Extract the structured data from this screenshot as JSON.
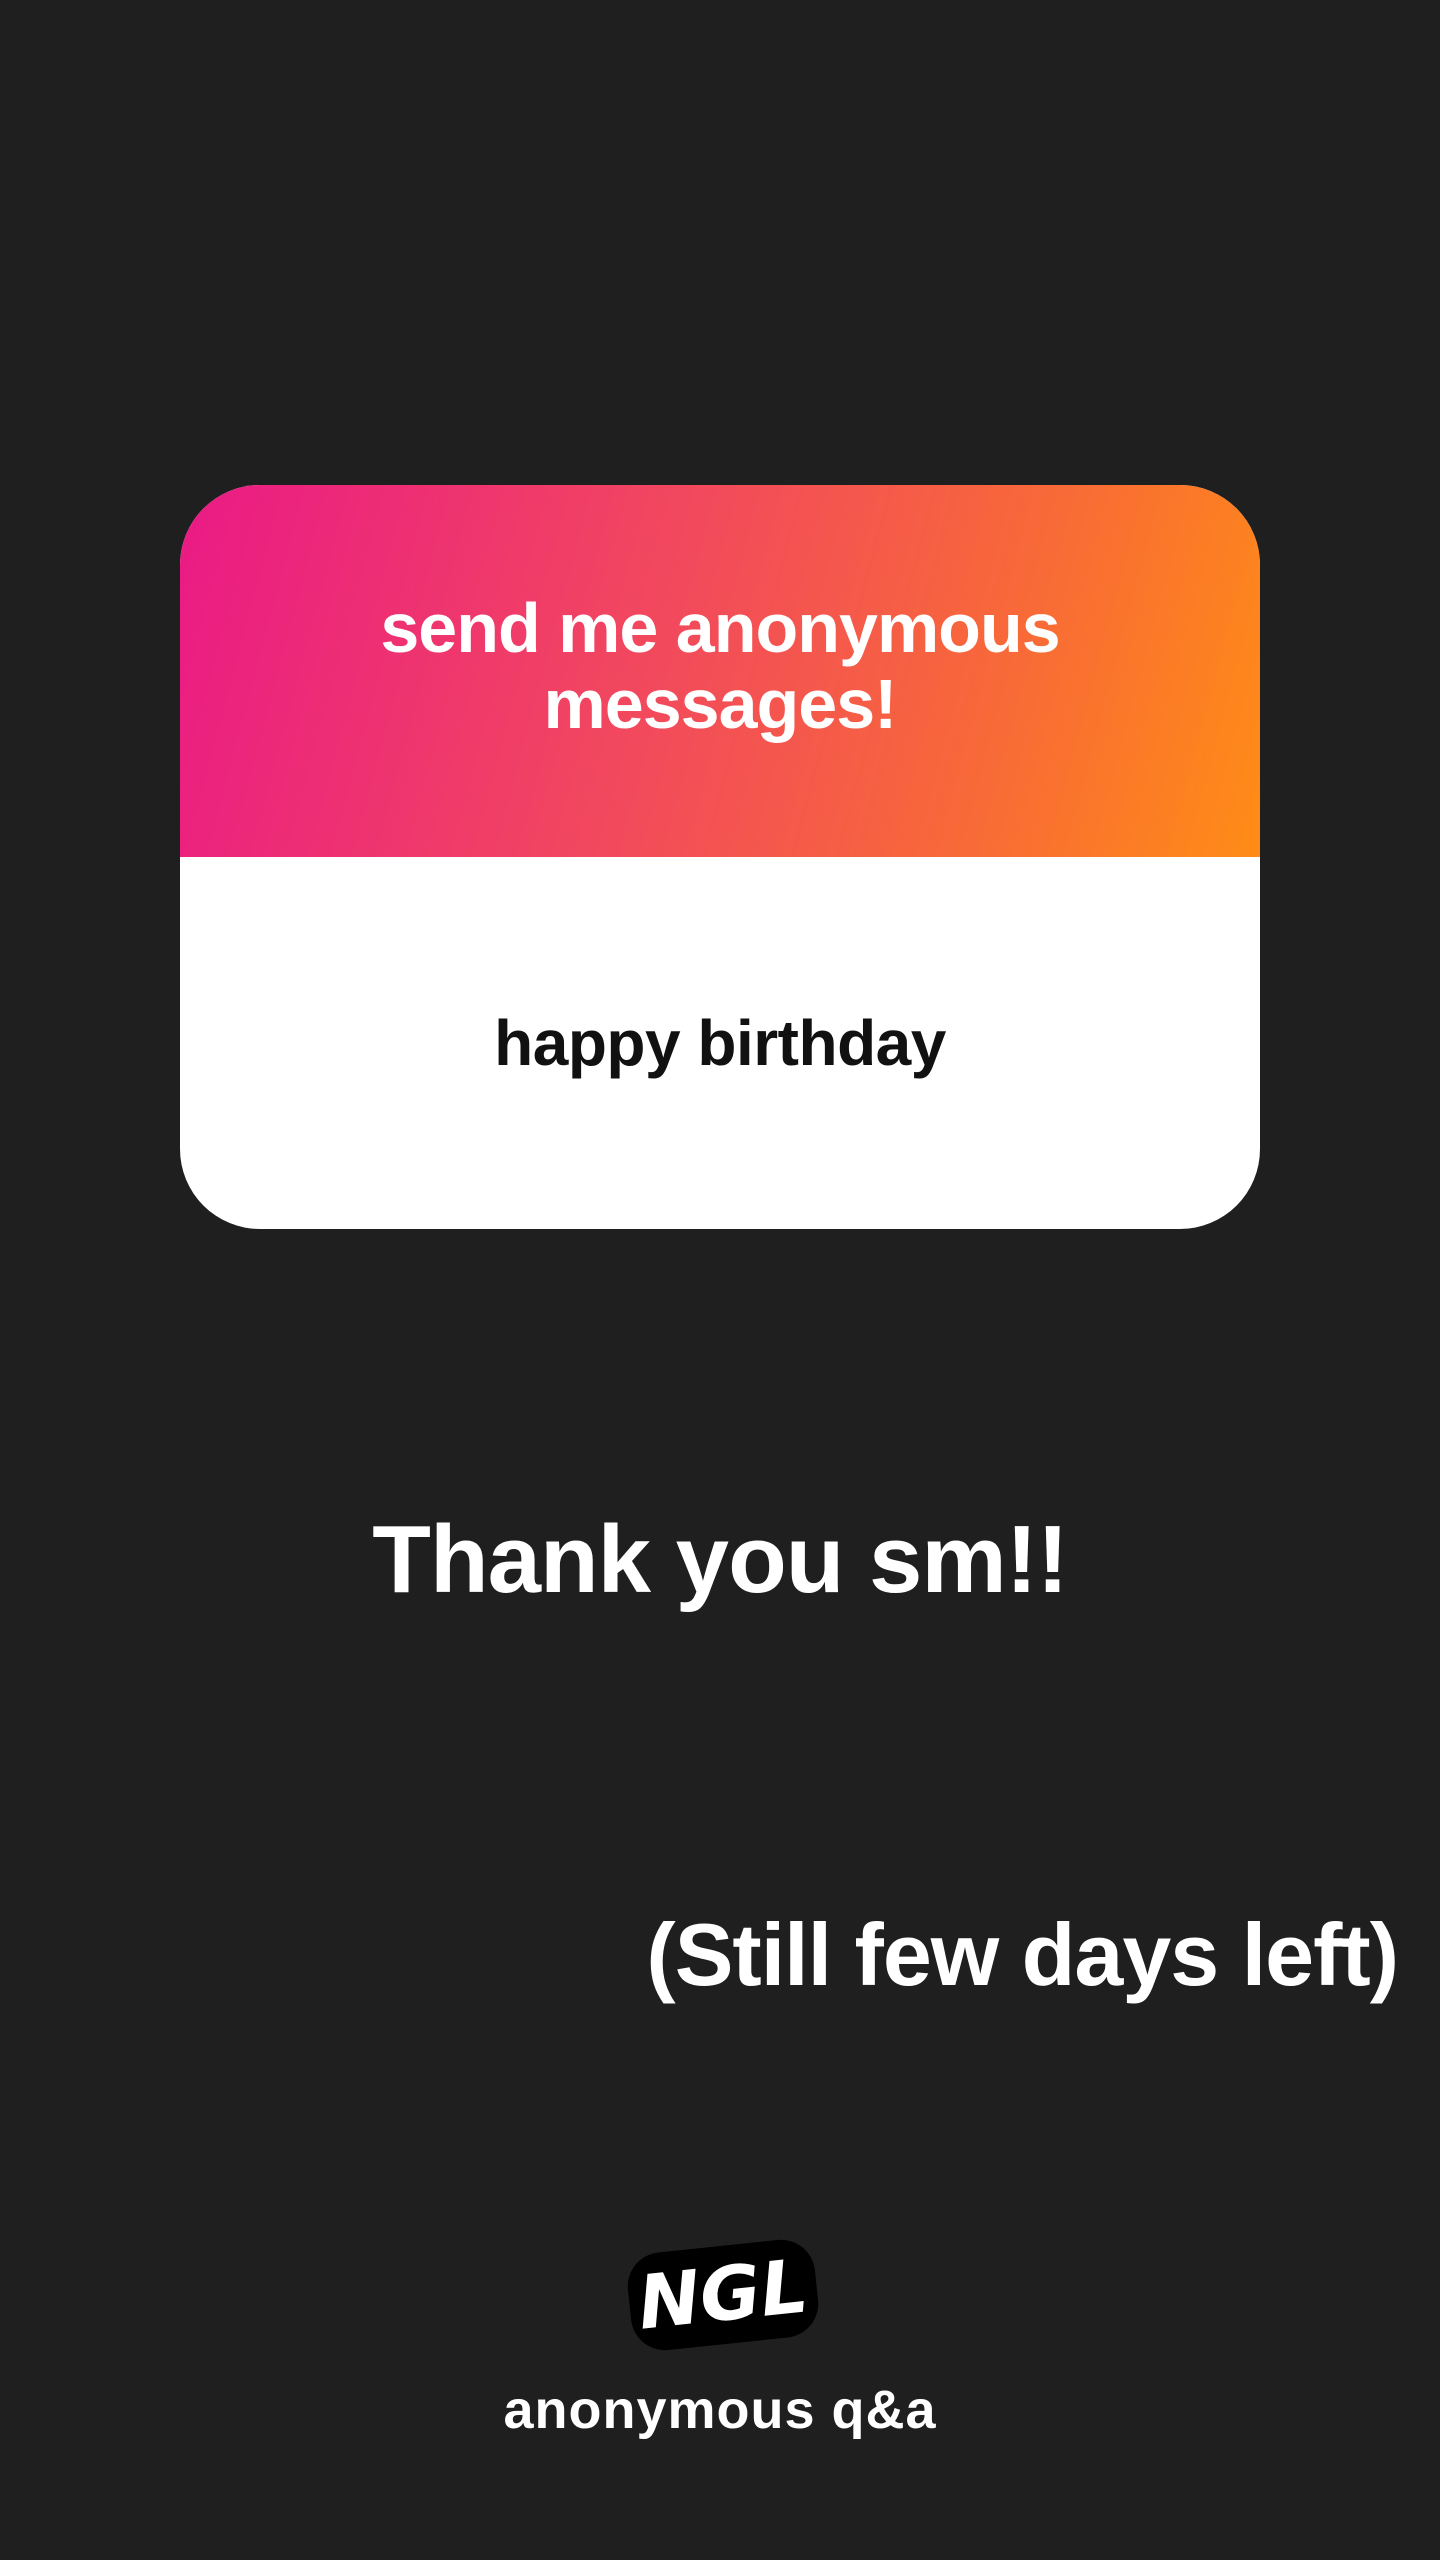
{
  "card": {
    "title": "send me anonymous messages!",
    "message": "happy birthday",
    "gradient_colors": [
      "#ea1a86",
      "#f24a5c",
      "#f86a37",
      "#ff8c16"
    ]
  },
  "captions": {
    "thanks": "Thank you sm!!",
    "days_left": "(Still few days left)"
  },
  "footer": {
    "logo_text": "NGL",
    "tagline": "anonymous q&a"
  },
  "colors": {
    "background": "#1f1f1f",
    "text_light": "#ffffff",
    "text_dark": "#111111"
  }
}
